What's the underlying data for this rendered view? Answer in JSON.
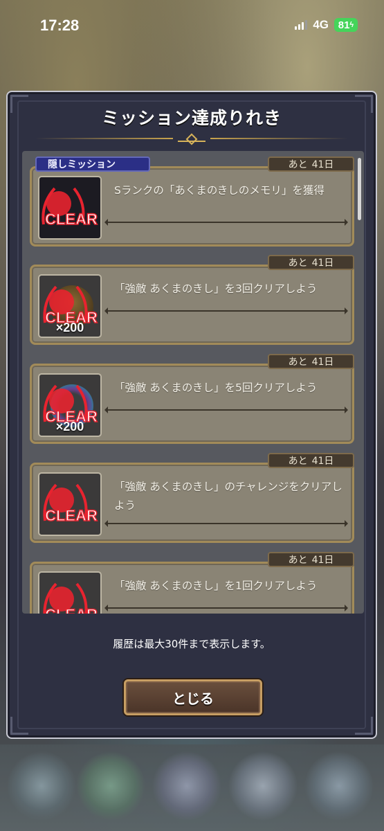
{
  "status_bar": {
    "time": "17:28",
    "network": "4G",
    "battery": "81"
  },
  "dialog": {
    "title": "ミッション達成りれき",
    "note": "履歴は最大30件まで表示します。",
    "close_label": "とじる"
  },
  "missions": [
    {
      "hidden_tag": "隠しミッション",
      "remaining_prefix": "あと",
      "remaining_days": "41日",
      "text": "Sランクの「あくまのきしのメモリ」を獲得",
      "reward_qty": "",
      "status": "CLEAR"
    },
    {
      "remaining_prefix": "あと",
      "remaining_days": "41日",
      "text": "「強敵 あくまのきし」を3回クリアしよう",
      "reward_qty": "×200",
      "status": "CLEAR"
    },
    {
      "remaining_prefix": "あと",
      "remaining_days": "41日",
      "text": "「強敵 あくまのきし」を5回クリアしよう",
      "reward_qty": "×200",
      "status": "CLEAR"
    },
    {
      "remaining_prefix": "あと",
      "remaining_days": "41日",
      "text": "「強敵 あくまのきし」のチャレンジをクリアしよう",
      "reward_qty": "",
      "status": "CLEAR"
    },
    {
      "remaining_prefix": "あと",
      "remaining_days": "41日",
      "text": "「強敵 あくまのきし」を1回クリアしよう",
      "reward_qty": "",
      "status": "CLEAR"
    }
  ],
  "colors": {
    "clear_stamp": "#e8232f",
    "accent_gold": "#c9a44d",
    "hidden_tag": "#2b2f86"
  }
}
